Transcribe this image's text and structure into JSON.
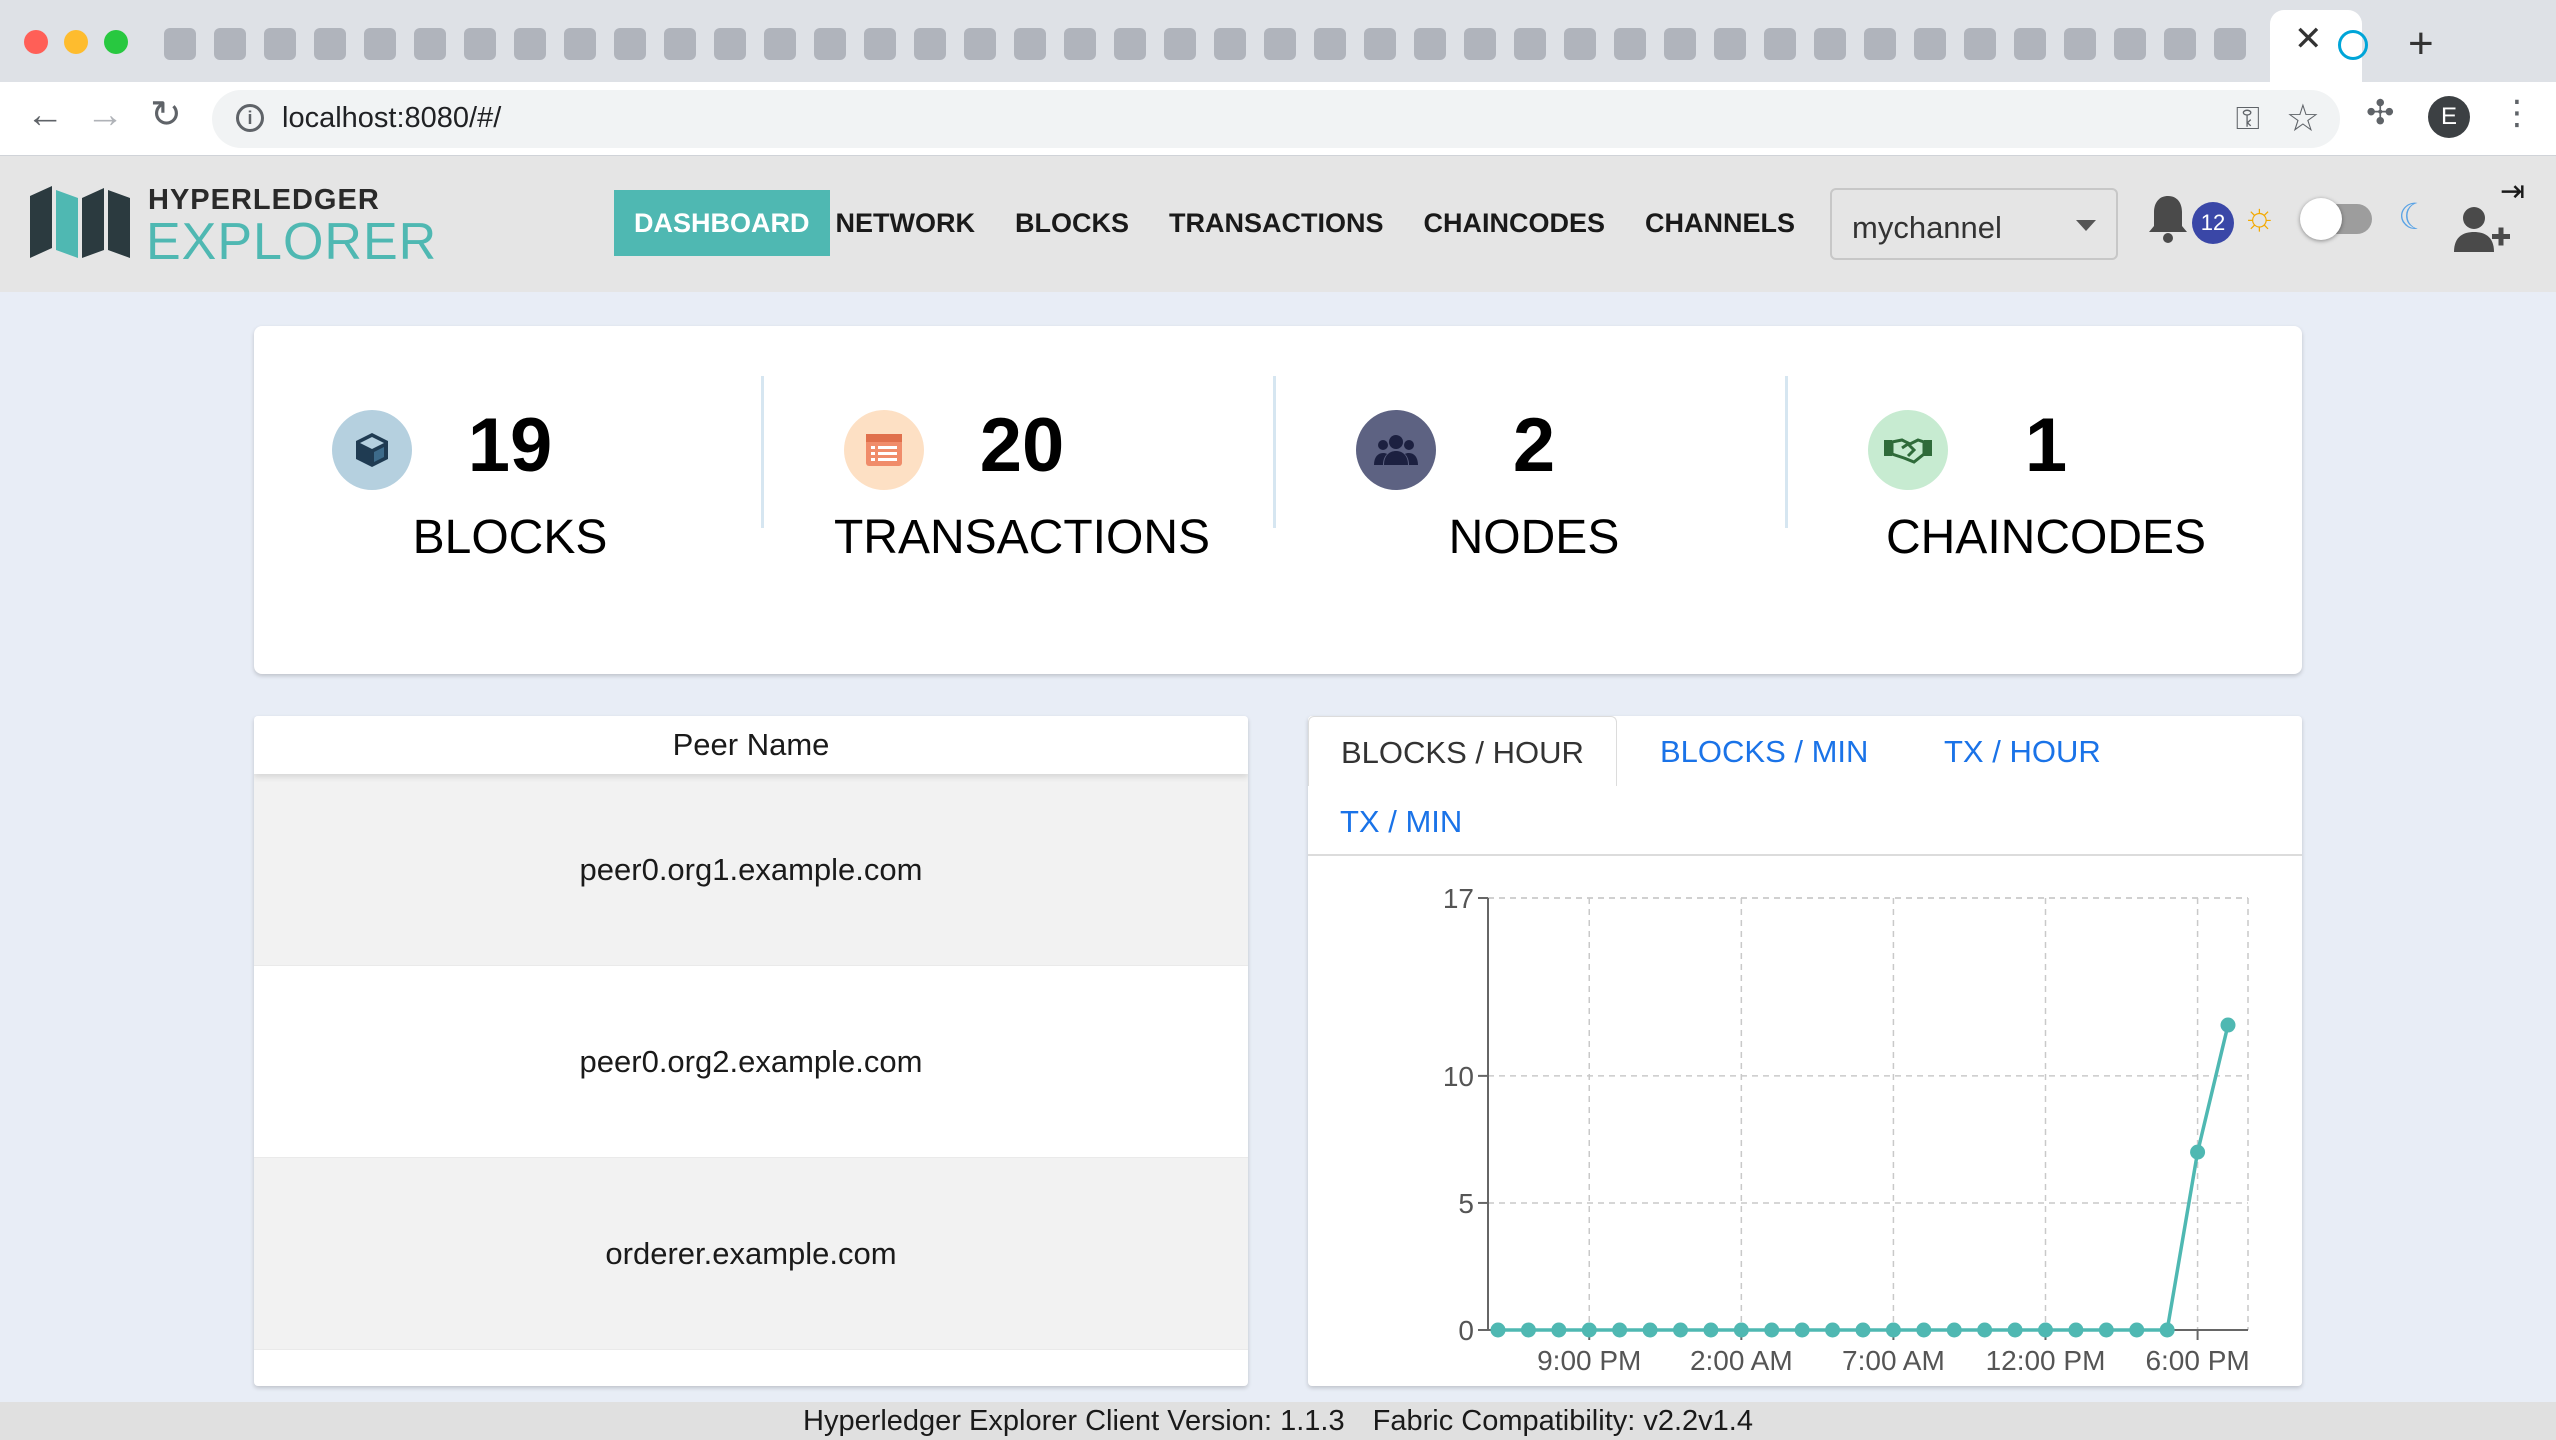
{
  "browser": {
    "url": "localhost:8080/#/",
    "profile_initial": "E"
  },
  "app": {
    "logo_top": "HYPERLEDGER",
    "logo_bottom": "EXPLORER",
    "nav": [
      "DASHBOARD",
      "NETWORK",
      "BLOCKS",
      "TRANSACTIONS",
      "CHAINCODES",
      "CHANNELS"
    ],
    "active_nav": "DASHBOARD",
    "channel": "mychannel",
    "notification_count": "12",
    "accent_color": "#4fb8b2"
  },
  "stats": [
    {
      "value": "19",
      "label": "BLOCKS",
      "icon": "cube-icon"
    },
    {
      "value": "20",
      "label": "TRANSACTIONS",
      "icon": "list-icon"
    },
    {
      "value": "2",
      "label": "NODES",
      "icon": "users-icon"
    },
    {
      "value": "1",
      "label": "CHAINCODES",
      "icon": "handshake-icon"
    }
  ],
  "peers": {
    "header": "Peer Name",
    "rows": [
      "peer0.org1.example.com",
      "peer0.org2.example.com",
      "orderer.example.com"
    ]
  },
  "chart_tabs": [
    "BLOCKS / HOUR",
    "BLOCKS / MIN",
    "TX / HOUR",
    "TX / MIN"
  ],
  "chart_data": {
    "type": "line",
    "title": "",
    "xlabel": "",
    "ylabel": "",
    "x_tick_labels": [
      "9:00 PM",
      "2:00 AM",
      "7:00 AM",
      "12:00 PM",
      "6:00 PM"
    ],
    "y_ticks": [
      0,
      5,
      10,
      17
    ],
    "ylim": [
      0,
      17
    ],
    "grid": true,
    "series": [
      {
        "values": [
          0,
          0,
          0,
          0,
          0,
          0,
          0,
          0,
          0,
          0,
          0,
          0,
          0,
          0,
          0,
          0,
          0,
          0,
          0,
          0,
          0,
          0,
          0,
          7,
          12
        ]
      }
    ],
    "line_color": "#4fb8b2"
  },
  "footer": {
    "client_version": "Hyperledger Explorer Client Version: 1.1.3",
    "fabric_compat": "Fabric Compatibility: v2.2v1.4"
  }
}
